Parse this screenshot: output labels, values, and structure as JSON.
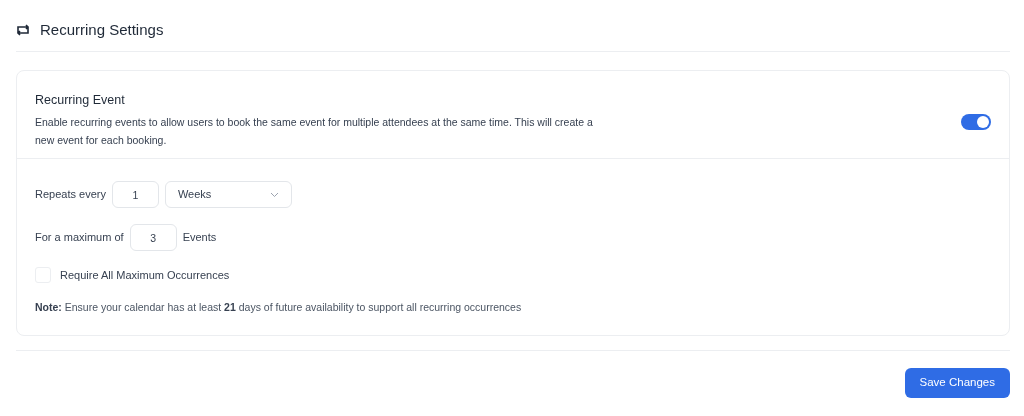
{
  "header": {
    "title": "Recurring Settings"
  },
  "recurring_event": {
    "title": "Recurring Event",
    "description": "Enable recurring events to allow users to book the same event for multiple attendees at the same time. This will create a new event for each booking.",
    "on": true
  },
  "repeats": {
    "label": "Repeats every",
    "value": "1",
    "unit": "Weeks"
  },
  "maximum": {
    "label": "For a maximum of",
    "value": "3",
    "suffix": "Events"
  },
  "require_all": {
    "label": "Require All Maximum Occurrences",
    "checked": false
  },
  "note": "**Note:** Ensure your calendar has at least **21** days of future availability to support all recurring occurrences",
  "save_button": "Save Changes"
}
